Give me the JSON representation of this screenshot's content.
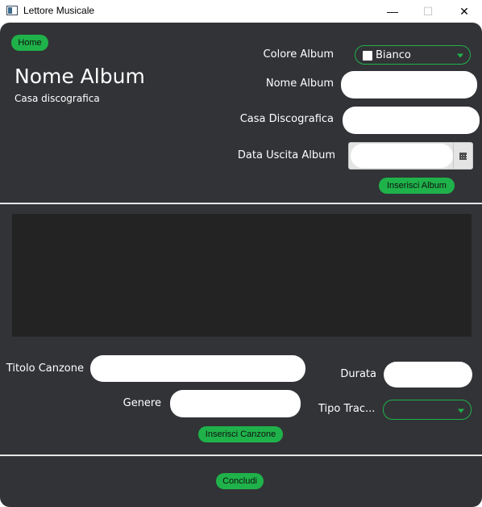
{
  "window": {
    "title": "Lettore Musicale",
    "minimize": "—",
    "maximize": "☐",
    "close": "✕"
  },
  "header": {
    "home_label": "Home",
    "album_name": "Nome Album",
    "label_name": "Casa discografica"
  },
  "album_form": {
    "color_label": "Colore Album",
    "color_value": "Bianco",
    "name_label": "Nome Album",
    "name_value": "",
    "label_label": "Casa Discografica",
    "label_value": "",
    "date_label": "Data Uscita Album",
    "date_value": "",
    "submit_label": "Inserisci Album"
  },
  "song_form": {
    "title_label": "Titolo Canzone",
    "title_value": "",
    "genre_label": "Genere",
    "genre_value": "",
    "duration_label": "Durata",
    "duration_value": "",
    "track_type_label": "Tipo Trac...",
    "track_type_value": "",
    "submit_label": "Inserisci Canzone"
  },
  "footer": {
    "finish_label": "Concludi"
  },
  "colors": {
    "background": "#323337",
    "accent": "#1fb24a",
    "list_background": "#232323",
    "text": "#ffffff"
  }
}
